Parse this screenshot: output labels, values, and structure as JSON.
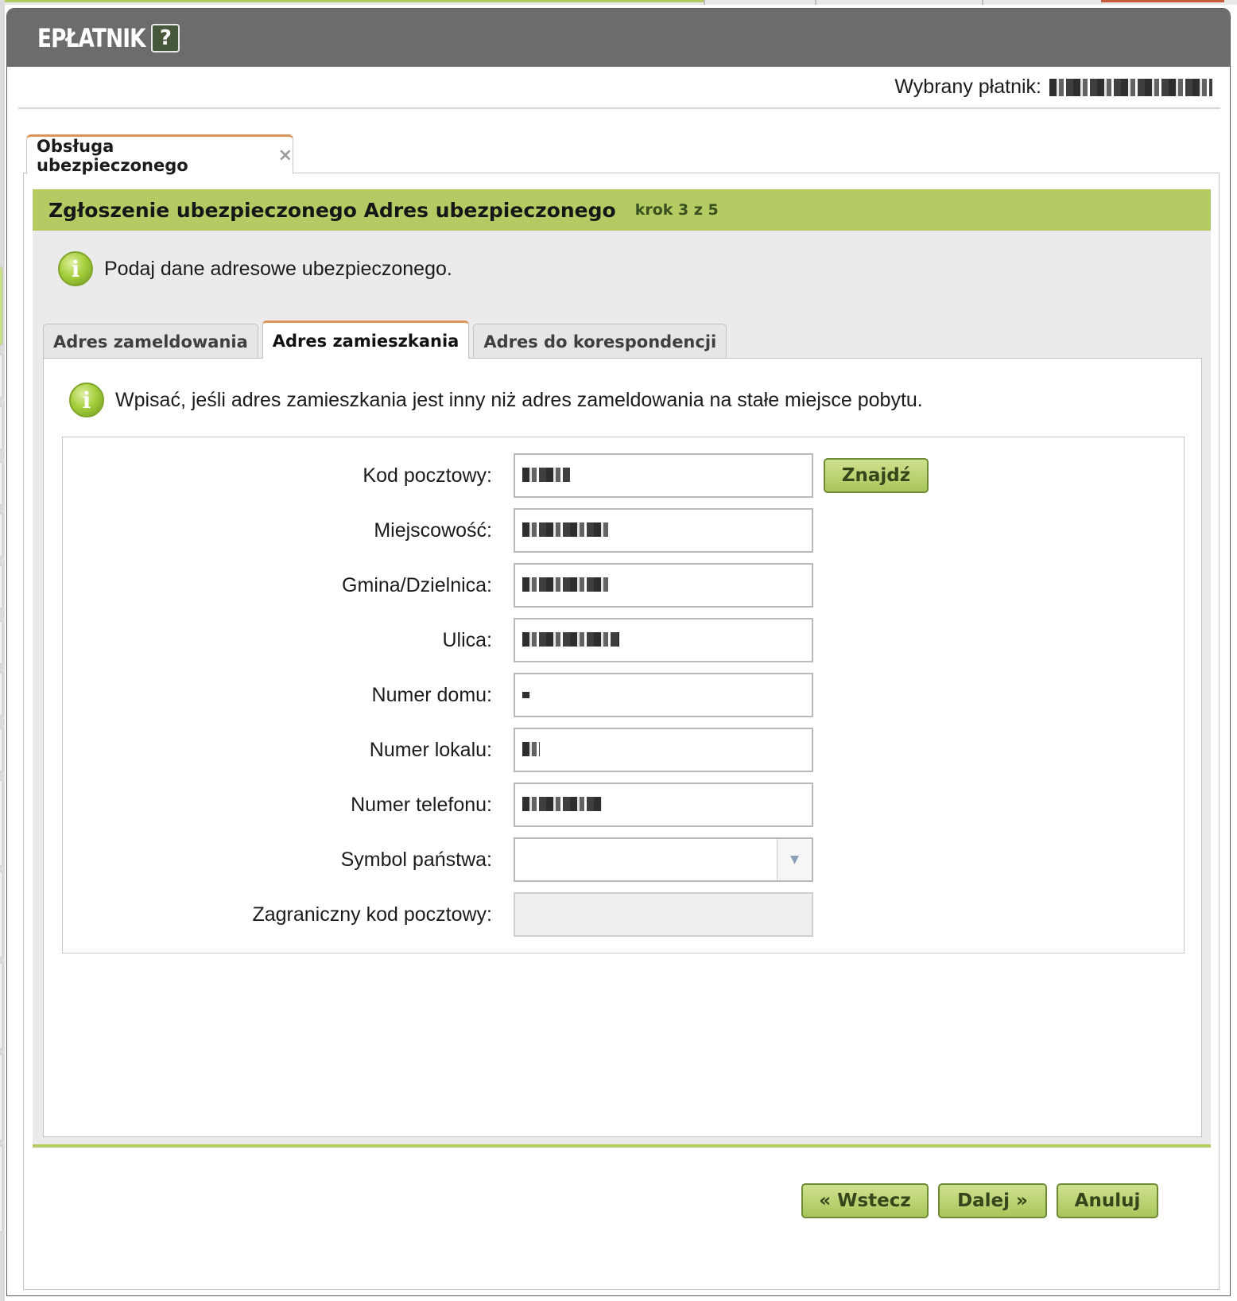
{
  "app": {
    "title": "EPŁATNIK",
    "help_label": "?"
  },
  "payer": {
    "label": "Wybrany płatnik:"
  },
  "outer_tab": {
    "label": "Obsługa ubezpieczonego",
    "close_label": "×"
  },
  "wizard": {
    "title": "Zgłoszenie ubezpieczonego Adres ubezpieczonego",
    "step": "krok 3 z 5",
    "info": "Podaj dane adresowe ubezpieczonego."
  },
  "address_tabs": [
    {
      "label": "Adres zameldowania",
      "active": false
    },
    {
      "label": "Adres zamieszkania",
      "active": true
    },
    {
      "label": "Adres do korespondencji",
      "active": false
    }
  ],
  "tab_info": "Wpisać, jeśli adres zamieszkania jest inny niż adres zameldowania na stałe miejsce pobytu.",
  "form": {
    "postal_code_label": "Kod pocztowy:",
    "city_label": "Miejscowość:",
    "commune_label": "Gmina/Dzielnica:",
    "street_label": "Ulica:",
    "house_number_label": "Numer domu:",
    "apartment_label": "Numer lokalu:",
    "phone_label": "Numer telefonu:",
    "country_label": "Symbol państwa:",
    "foreign_postal_label": "Zagraniczny kod pocztowy:",
    "find_button": "Znajdź"
  },
  "actions": {
    "back": "« Wstecz",
    "next": "Dalej »",
    "cancel": "Anuluj"
  },
  "colors": {
    "accent_green": "#b3cb62",
    "tab_accent": "#d9955a",
    "titlebar": "#6c6d6b"
  }
}
